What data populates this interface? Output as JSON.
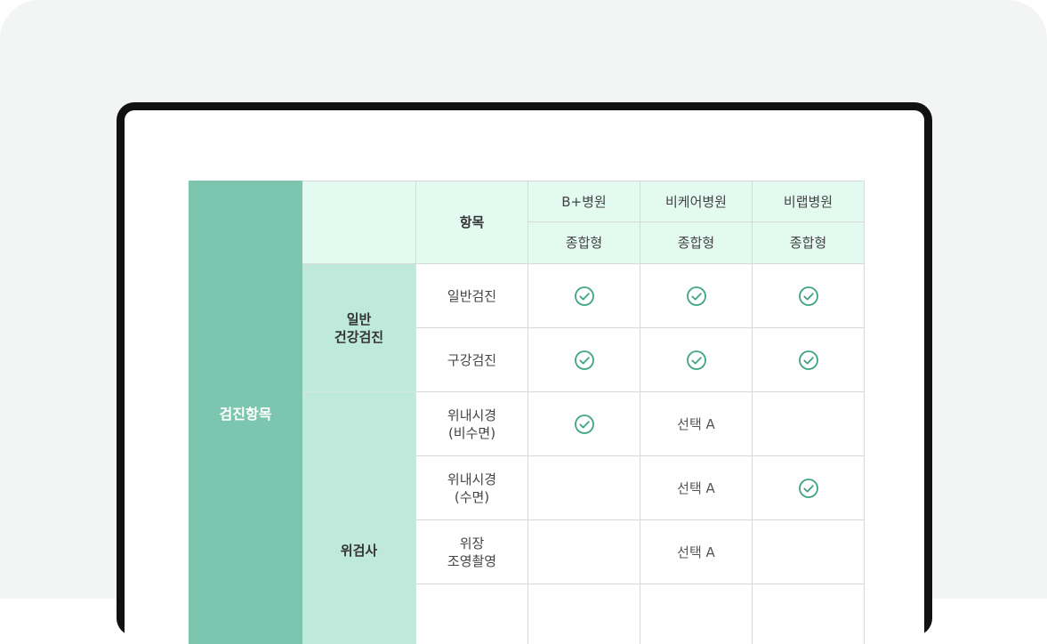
{
  "table": {
    "category": "검진항목",
    "header_item": "항목",
    "hospitals": [
      {
        "name": "B+병원",
        "type": "종합형"
      },
      {
        "name": "비케어병원",
        "type": "종합형"
      },
      {
        "name": "비랩병원",
        "type": "종합형"
      }
    ],
    "groups": [
      {
        "label": "일반\n건강검진"
      },
      {
        "label": "위검사"
      }
    ],
    "rows": [
      {
        "item": "일반검진",
        "cells": [
          "check",
          "check",
          "check"
        ]
      },
      {
        "item": "구강검진",
        "cells": [
          "check",
          "check",
          "check"
        ]
      },
      {
        "item": "위내시경\n(비수면)",
        "cells": [
          "check",
          "선택 A",
          ""
        ]
      },
      {
        "item": "위내시경\n(수면)",
        "cells": [
          "",
          "선택 A",
          "check"
        ]
      },
      {
        "item": "위장\n조영촬영",
        "cells": [
          "",
          "선택 A",
          ""
        ]
      },
      {
        "item": "",
        "cells": [
          "",
          "",
          ""
        ]
      }
    ],
    "check_color": "#3da67e",
    "icon": "check-circle-icon"
  }
}
